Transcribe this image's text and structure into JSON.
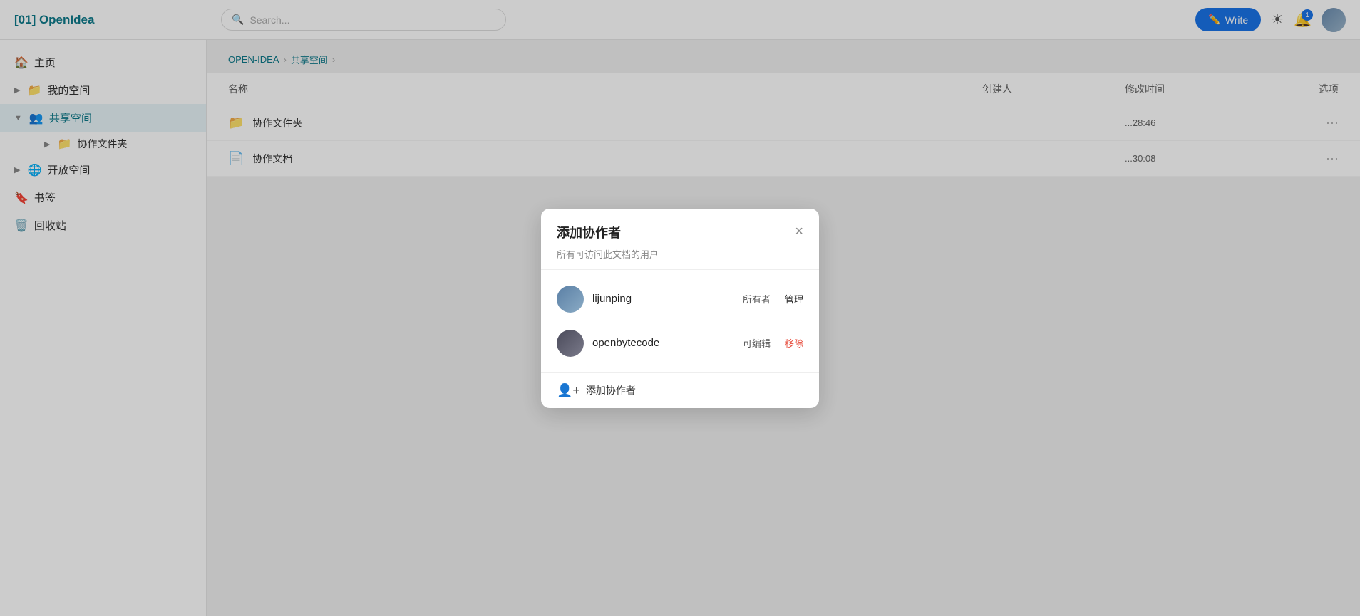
{
  "header": {
    "logo": "[01] OpenIdea",
    "search_placeholder": "Search...",
    "write_label": "Write"
  },
  "sidebar": {
    "items": [
      {
        "id": "home",
        "label": "主页",
        "icon": "🏠",
        "active": false,
        "indent": 0
      },
      {
        "id": "my-space",
        "label": "我的空间",
        "icon": "📁",
        "active": false,
        "indent": 0
      },
      {
        "id": "shared-space",
        "label": "共享空间",
        "icon": "👥",
        "active": true,
        "indent": 0
      },
      {
        "id": "collab-folder",
        "label": "协作文件夹",
        "icon": "📁",
        "active": false,
        "indent": 1
      },
      {
        "id": "open-space",
        "label": "开放空间",
        "icon": "🌐",
        "active": false,
        "indent": 0
      },
      {
        "id": "bookmarks",
        "label": "书签",
        "icon": "🔖",
        "active": false,
        "indent": 0
      },
      {
        "id": "trash",
        "label": "回收站",
        "icon": "🗑️",
        "active": false,
        "indent": 0
      }
    ]
  },
  "breadcrumb": {
    "items": [
      "OPEN-IDEA",
      "共享空间"
    ]
  },
  "file_table": {
    "headers": [
      "名称",
      "创建人",
      "修改时间",
      "选项"
    ],
    "rows": [
      {
        "name": "协作文件夹",
        "type": "folder",
        "creator": "",
        "modified": "28:46"
      },
      {
        "name": "协作文档",
        "type": "doc",
        "creator": "",
        "modified": "30:08"
      }
    ]
  },
  "modal": {
    "title": "添加协作者",
    "subtitle": "所有可访问此文档的用户",
    "close_label": "×",
    "collaborators": [
      {
        "name": "lijunping",
        "role": "所有者",
        "action": "管理",
        "action_type": "manage"
      },
      {
        "name": "openbytecode",
        "role": "可编辑",
        "action": "移除",
        "action_type": "remove"
      }
    ],
    "add_label": "添加协作者"
  },
  "icons": {
    "search": "🔍",
    "write_pencil": "✏️",
    "sun": "☀",
    "bell": "🔔",
    "notification_count": "1"
  }
}
